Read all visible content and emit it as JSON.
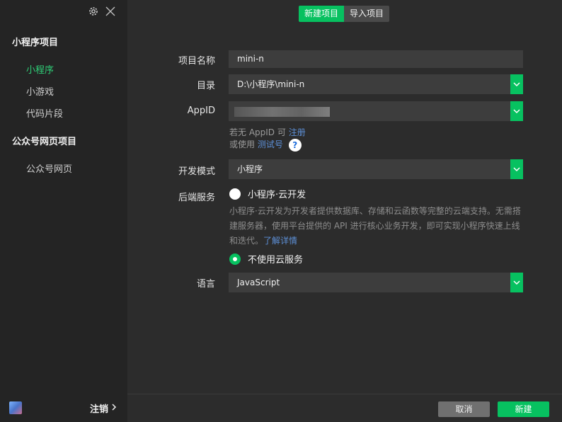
{
  "sidebar": {
    "sections": [
      {
        "title": "小程序项目",
        "items": [
          {
            "label": "小程序",
            "active": true
          },
          {
            "label": "小游戏",
            "active": false
          },
          {
            "label": "代码片段",
            "active": false
          }
        ]
      },
      {
        "title": "公众号网页项目",
        "items": [
          {
            "label": "公众号网页",
            "active": false
          }
        ]
      }
    ],
    "logout_label": "注销",
    "icons": [
      "gear-icon",
      "close-icon"
    ]
  },
  "tabs": [
    {
      "label": "新建项目",
      "active": true
    },
    {
      "label": "导入项目",
      "active": false
    }
  ],
  "form": {
    "name": {
      "label": "项目名称",
      "value": "mini-n"
    },
    "dir": {
      "label": "目录",
      "value": "D:\\小程序\\mini-n"
    },
    "appid": {
      "label": "AppID",
      "hint_prefix": "若无 AppID 可",
      "hint_link": "注册",
      "hint2_prefix": "或使用",
      "hint2_link": "测试号",
      "help_glyph": "?"
    },
    "mode": {
      "label": "开发模式",
      "value": "小程序"
    },
    "backend": {
      "label": "后端服务",
      "option_cloud": "小程序·云开发",
      "desc_line1": "小程序·云开发为开发者提供数据库、存储和云函数等完整的云端支持。无需搭",
      "desc_line2": "建服务器，使用平台提供的 API 进行核心业务开发，即可实现小程序快速上线",
      "desc_line3_prefix": "和迭代。",
      "desc_link": "了解详情",
      "option_none": "不使用云服务",
      "selected": "不使用云服务"
    },
    "lang": {
      "label": "语言",
      "value": "JavaScript"
    }
  },
  "footer": {
    "cancel_label": "取消",
    "create_label": "新建"
  },
  "colors": {
    "accent": "#07c160",
    "link": "#5d8fd6"
  }
}
